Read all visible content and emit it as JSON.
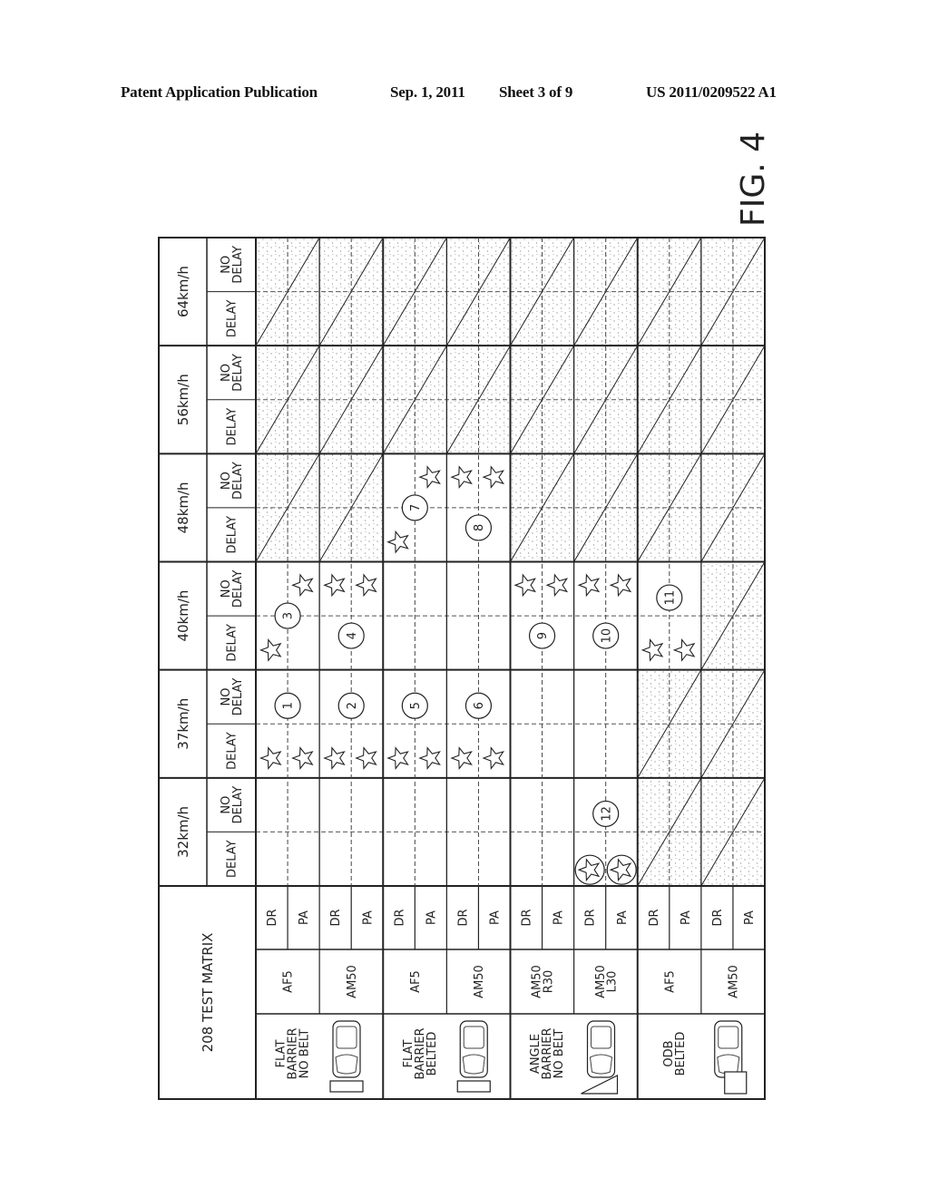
{
  "header": {
    "publication": "Patent Application Publication",
    "date": "Sep. 1, 2011",
    "sheet": "Sheet 3 of 9",
    "number": "US 2011/0209522 A1"
  },
  "figure_label": "FIG. 4",
  "matrix": {
    "title": "208 TEST MATRIX",
    "delay_labels": {
      "delay": "DELAY",
      "no_delay_1": "NO",
      "no_delay_2": "DELAY"
    },
    "speeds": [
      "32km/h",
      "37km/h",
      "40km/h",
      "48km/h",
      "56km/h",
      "64km/h"
    ],
    "test_groups": [
      {
        "name": [
          "FLAT",
          "BARRIER",
          "NO BELT"
        ],
        "barrier": "flat",
        "dummies": [
          [
            "AF5"
          ],
          [
            "AM50"
          ]
        ]
      },
      {
        "name": [
          "FLAT",
          "BARRIER",
          "BELTED"
        ],
        "barrier": "flat",
        "dummies": [
          [
            "AF5"
          ],
          [
            "AM50"
          ]
        ]
      },
      {
        "name": [
          "ANGLE",
          "BARRIER",
          "NO BELT"
        ],
        "barrier": "angle",
        "dummies": [
          [
            "AM50",
            "R30"
          ],
          [
            "AM50",
            "L30"
          ]
        ]
      },
      {
        "name": [
          "ODB",
          "BELTED"
        ],
        "barrier": "odb",
        "dummies": [
          [
            "AF5"
          ],
          [
            "AM50"
          ]
        ]
      }
    ],
    "positions": [
      "DR",
      "PA"
    ],
    "shaded": {
      "64km/h": [
        true,
        true,
        true,
        true,
        true,
        true,
        true,
        true
      ],
      "56km/h": [
        true,
        true,
        true,
        true,
        true,
        true,
        true,
        true
      ],
      "48km/h": [
        true,
        true,
        false,
        false,
        true,
        true,
        true,
        true
      ],
      "40km/h": [
        false,
        false,
        false,
        false,
        false,
        false,
        false,
        true
      ],
      "37km/h": [
        false,
        false,
        false,
        false,
        false,
        false,
        true,
        true
      ],
      "32km/h": [
        false,
        false,
        false,
        false,
        false,
        false,
        true,
        true
      ]
    },
    "tests": [
      {
        "id": "1",
        "speed": "37km/h",
        "stars": [
          {
            "col": 0,
            "delay": true
          },
          {
            "col": 1,
            "delay": true
          }
        ]
      },
      {
        "id": "2",
        "speed": "37km/h",
        "stars": [
          {
            "col": 2,
            "delay": true
          },
          {
            "col": 3,
            "delay": true
          }
        ]
      },
      {
        "id": "3",
        "speed": "40km/h",
        "stars": [
          {
            "col": 0,
            "delay": true
          },
          {
            "col": 1,
            "delay": false
          }
        ]
      },
      {
        "id": "4",
        "speed": "40km/h",
        "stars": [
          {
            "col": 2,
            "delay": false
          },
          {
            "col": 3,
            "delay": false
          }
        ]
      },
      {
        "id": "5",
        "speed": "37km/h",
        "stars": [
          {
            "col": 4,
            "delay": true
          },
          {
            "col": 5,
            "delay": true
          }
        ]
      },
      {
        "id": "6",
        "speed": "37km/h",
        "stars": [
          {
            "col": 6,
            "delay": true
          },
          {
            "col": 7,
            "delay": true
          }
        ]
      },
      {
        "id": "7",
        "speed": "48km/h",
        "stars": [
          {
            "col": 4,
            "delay": true
          },
          {
            "col": 5,
            "delay": false
          }
        ]
      },
      {
        "id": "8",
        "speed": "48km/h",
        "stars": [
          {
            "col": 6,
            "delay": false
          },
          {
            "col": 7,
            "delay": false
          }
        ]
      },
      {
        "id": "9",
        "speed": "40km/h",
        "stars": [
          {
            "col": 8,
            "delay": false
          },
          {
            "col": 9,
            "delay": false
          }
        ]
      },
      {
        "id": "10",
        "speed": "40km/h",
        "stars": [
          {
            "col": 10,
            "delay": false
          },
          {
            "col": 11,
            "delay": false
          }
        ]
      },
      {
        "id": "11",
        "speed": "40km/h",
        "stars": [
          {
            "col": 12,
            "delay": true
          },
          {
            "col": 13,
            "delay": true
          }
        ]
      },
      {
        "id": "12",
        "speed": "32km/h",
        "stars": [
          {
            "col": 10,
            "delay": true,
            "circled": true
          },
          {
            "col": 11,
            "delay": true,
            "circled": true
          }
        ]
      }
    ]
  }
}
